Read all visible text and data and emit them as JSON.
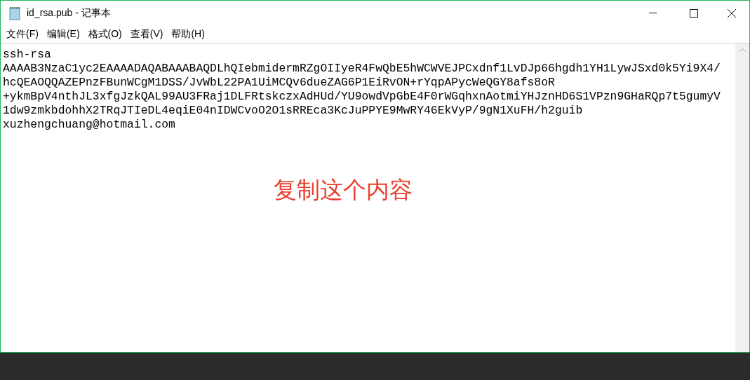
{
  "window": {
    "title": "id_rsa.pub - 记事本"
  },
  "menu": [
    "文件(F)",
    "编辑(E)",
    "格式(O)",
    "查看(V)",
    "帮助(H)"
  ],
  "editor": {
    "lines": [
      "ssh-rsa",
      "AAAAB3NzaC1yc2EAAAADAQABAAABAQDLhQIebmidermRZgOIIyeR4FwQbE5hWCWVEJPCxdnf1LvDJp66hgdh1YH1LywJSxd0k5Yi9X4/",
      "hcQEAOQQAZEPnzFBunWCgM1DSS/JvWbL22PA1UiMCQv6dueZAG6P1EiRvON+rYqpAPycWeQGY8afs8oR",
      "+ykmBpV4nthJL3xfgJzkQAL99AU3FRaj1DLFRtskczxAdHUd/YU9owdVpGbE4F0rWGqhxnAotmiYHJznHD6S1VPzn9GHaRQp7t5gumyV",
      "1dw9zmkbdohhX2TRqJTIeDL4eqiE04nIDWCvoO2O1sRREca3KcJuPPYE9MwRY46EkVyP/9gN1XuFH/h2guib",
      "xuzhengchuang@hotmail.com"
    ]
  },
  "annotation": "复制这个内容"
}
